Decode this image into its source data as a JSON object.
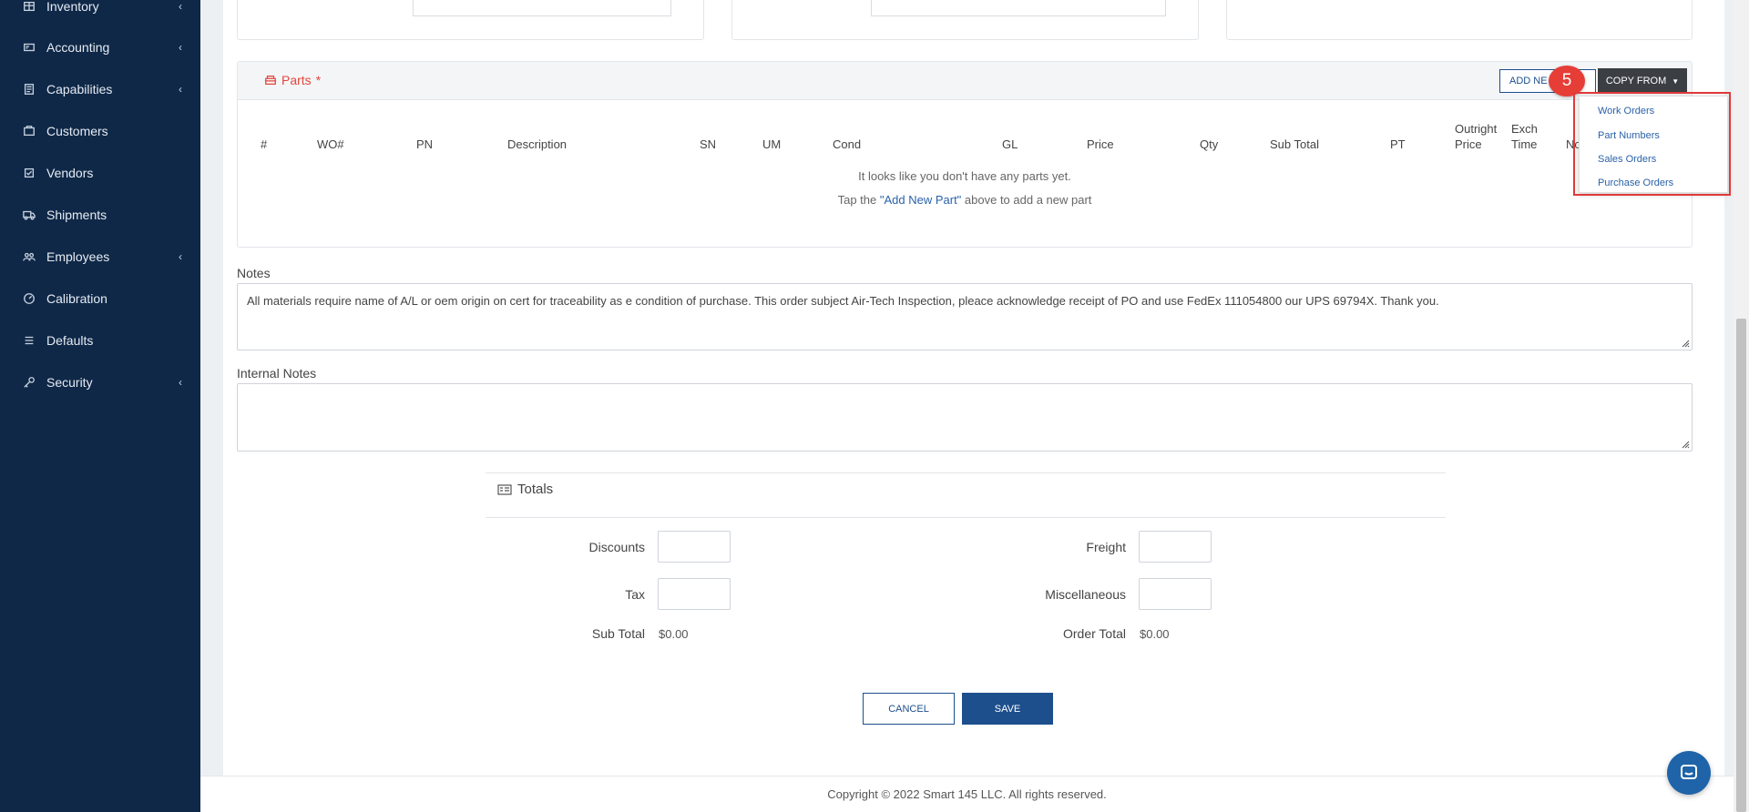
{
  "sidebar": {
    "items": [
      {
        "label": "Inventory",
        "icon": "inventory-icon",
        "has_submenu": true
      },
      {
        "label": "Accounting",
        "icon": "accounting-icon",
        "has_submenu": true
      },
      {
        "label": "Capabilities",
        "icon": "capabilities-icon",
        "has_submenu": true
      },
      {
        "label": "Customers",
        "icon": "customers-icon",
        "has_submenu": false
      },
      {
        "label": "Vendors",
        "icon": "vendors-icon",
        "has_submenu": false
      },
      {
        "label": "Shipments",
        "icon": "shipments-icon",
        "has_submenu": false
      },
      {
        "label": "Employees",
        "icon": "employees-icon",
        "has_submenu": true
      },
      {
        "label": "Calibration",
        "icon": "calibration-icon",
        "has_submenu": false
      },
      {
        "label": "Defaults",
        "icon": "defaults-icon",
        "has_submenu": false
      },
      {
        "label": "Security",
        "icon": "security-icon",
        "has_submenu": true
      }
    ],
    "chevron": "‹"
  },
  "parts": {
    "title": "Parts",
    "required_mark": "*",
    "add_new_label": "ADD NE",
    "copy_from_label": "COPY FROM",
    "step_badge": "5",
    "columns": [
      "#",
      "WO#",
      "PN",
      "Description",
      "SN",
      "UM",
      "Cond",
      "GL",
      "Price",
      "Qty",
      "Sub Total",
      "PT",
      "Outright Price",
      "Exch Time",
      "No"
    ],
    "empty_message": "It looks like you don't have any parts yet.",
    "empty_hint_prefix": "Tap the ",
    "empty_hint_link": "\"Add New Part\"",
    "empty_hint_suffix": " above to add a new part"
  },
  "copy_from_menu": {
    "items": [
      "Work Orders",
      "Part Numbers",
      "Sales Orders",
      "Purchase Orders"
    ]
  },
  "notes": {
    "label": "Notes",
    "value": "All materials require name of A/L or oem origin on cert for traceability as e condition of purchase. This order subject Air-Tech Inspection, pleace acknowledge receipt of PO and use FedEx 111054800 our UPS 69794X. Thank you."
  },
  "internal_notes": {
    "label": "Internal Notes",
    "value": ""
  },
  "totals": {
    "title": "Totals",
    "discounts_label": "Discounts",
    "tax_label": "Tax",
    "sub_total_label": "Sub Total",
    "sub_total_value": "$0.00",
    "freight_label": "Freight",
    "miscellaneous_label": "Miscellaneous",
    "order_total_label": "Order Total",
    "order_total_value": "$0.00"
  },
  "actions": {
    "cancel_label": "CANCEL",
    "save_label": "SAVE"
  },
  "footer": {
    "copyright": "Copyright © 2022 Smart 145 LLC. All rights reserved."
  },
  "colors": {
    "sidebar_bg": "#0f2848",
    "primary": "#1c4f8c",
    "required": "#e0473d",
    "highlight": "#e03a3a"
  }
}
